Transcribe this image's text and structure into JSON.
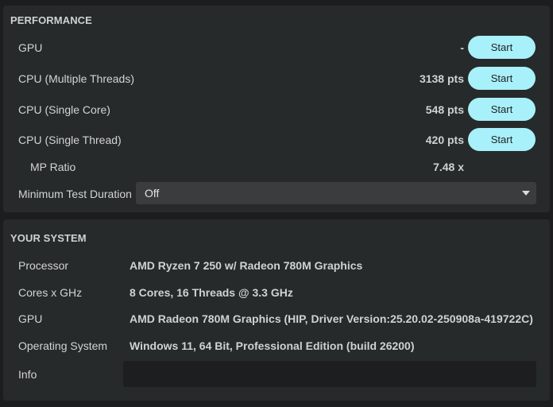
{
  "performance": {
    "title": "PERFORMANCE",
    "rows": [
      {
        "label": "GPU",
        "score": "-",
        "button": "Start"
      },
      {
        "label": "CPU (Multiple Threads)",
        "score": "3138 pts",
        "button": "Start"
      },
      {
        "label": "CPU (Single Core)",
        "score": "548 pts",
        "button": "Start"
      },
      {
        "label": "CPU (Single Thread)",
        "score": "420 pts",
        "button": "Start"
      }
    ],
    "mp_ratio": {
      "label": "MP Ratio",
      "value": "7.48 x"
    },
    "min_duration": {
      "label": "Minimum Test Duration",
      "value": "Off"
    }
  },
  "system": {
    "title": "YOUR SYSTEM",
    "rows": [
      {
        "label": "Processor",
        "value": "AMD Ryzen 7 250 w/ Radeon 780M Graphics"
      },
      {
        "label": "Cores x GHz",
        "value": "8 Cores, 16 Threads @ 3.3 GHz"
      },
      {
        "label": "GPU",
        "value": "AMD Radeon 780M Graphics (HIP, Driver Version:25.20.02-250908a-419722C)"
      },
      {
        "label": "Operating System",
        "value": "Windows 11, 64 Bit, Professional Edition (build 26200)"
      }
    ],
    "info": {
      "label": "Info",
      "value": ""
    }
  },
  "colors": {
    "background": "#1b1d1e",
    "panel": "#272a2b",
    "button_accent": "#a8f0fa",
    "dropdown": "#3a3c3d",
    "info_box": "#1c1e1f"
  }
}
